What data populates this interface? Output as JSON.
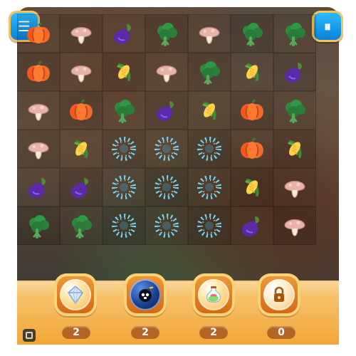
{
  "board": {
    "rows": 6,
    "cols": 7,
    "tiles": [
      [
        "pumpkin",
        "mushroom",
        "eggplant",
        "broccoli",
        "mushroom",
        "broccoli",
        "broccoli"
      ],
      [
        "pumpkin",
        "mushroom",
        "corn",
        "mushroom",
        "broccoli",
        "corn",
        "eggplant"
      ],
      [
        "mushroom",
        "pumpkin",
        "broccoli",
        "eggplant",
        "corn",
        "pumpkin",
        "broccoli"
      ],
      [
        "mushroom",
        "corn",
        "sparkle",
        "sparkle",
        "sparkle",
        "pumpkin",
        "corn"
      ],
      [
        "eggplant",
        "eggplant",
        "sparkle",
        "sparkle",
        "sparkle",
        "corn",
        "mushroom"
      ],
      [
        "broccoli",
        "broccoli",
        "sparkle",
        "sparkle",
        "sparkle",
        "eggplant",
        "mushroom"
      ]
    ]
  },
  "top_buttons": {
    "menu_label": "☰",
    "pause_label": "⏸"
  },
  "boosters": [
    {
      "name": "diamond",
      "count": "2"
    },
    {
      "name": "bomb",
      "count": "2"
    },
    {
      "name": "potion",
      "count": "2"
    },
    {
      "name": "locked",
      "count": "0"
    }
  ]
}
